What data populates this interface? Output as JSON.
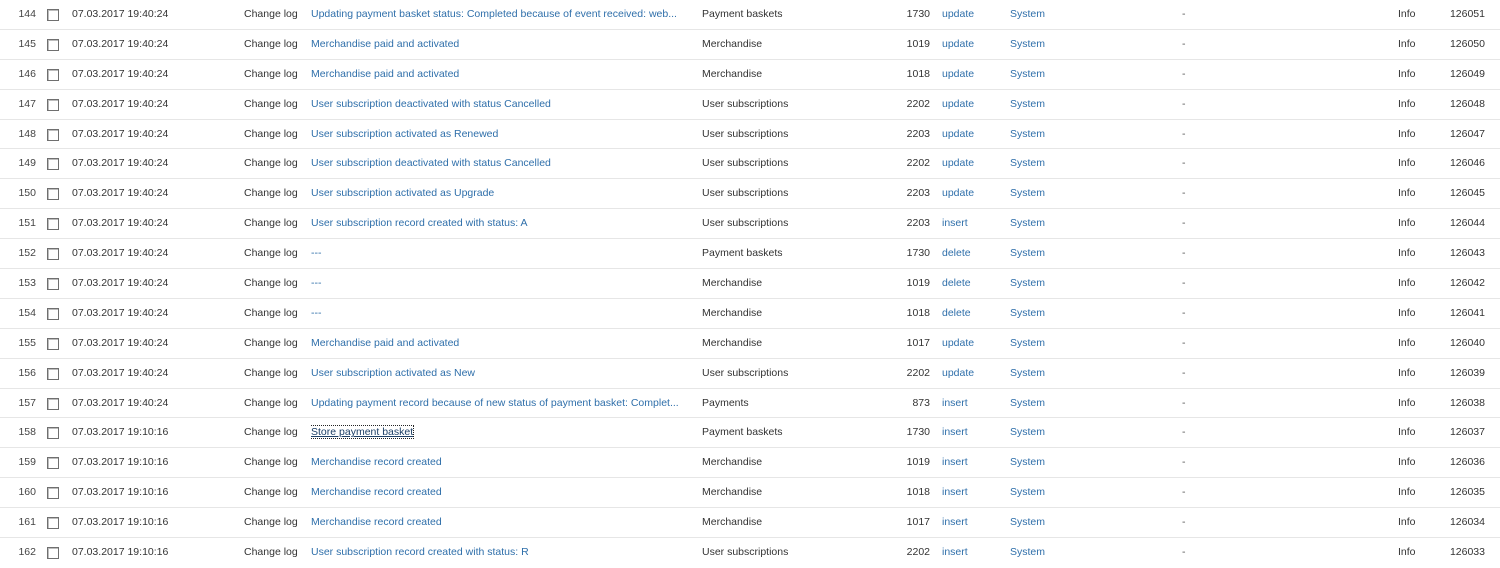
{
  "log": {
    "rows": [
      {
        "num": "144",
        "date": "07.03.2017 19:40:24",
        "type": "Change log",
        "message": "Updating payment basket status: Completed because of event received: web...",
        "object": "Payment baskets",
        "object_id": "1730",
        "action": "update",
        "user": "System",
        "dash": "-",
        "level": "Info",
        "record_id": "126051"
      },
      {
        "num": "145",
        "date": "07.03.2017 19:40:24",
        "type": "Change log",
        "message": "Merchandise paid and activated",
        "object": "Merchandise",
        "object_id": "1019",
        "action": "update",
        "user": "System",
        "dash": "-",
        "level": "Info",
        "record_id": "126050"
      },
      {
        "num": "146",
        "date": "07.03.2017 19:40:24",
        "type": "Change log",
        "message": "Merchandise paid and activated",
        "object": "Merchandise",
        "object_id": "1018",
        "action": "update",
        "user": "System",
        "dash": "-",
        "level": "Info",
        "record_id": "126049"
      },
      {
        "num": "147",
        "date": "07.03.2017 19:40:24",
        "type": "Change log",
        "message": "User subscription deactivated with status Cancelled",
        "object": "User subscriptions",
        "object_id": "2202",
        "action": "update",
        "user": "System",
        "dash": "-",
        "level": "Info",
        "record_id": "126048"
      },
      {
        "num": "148",
        "date": "07.03.2017 19:40:24",
        "type": "Change log",
        "message": "User subscription activated as Renewed",
        "object": "User subscriptions",
        "object_id": "2203",
        "action": "update",
        "user": "System",
        "dash": "-",
        "level": "Info",
        "record_id": "126047"
      },
      {
        "num": "149",
        "date": "07.03.2017 19:40:24",
        "type": "Change log",
        "message": "User subscription deactivated with status Cancelled",
        "object": "User subscriptions",
        "object_id": "2202",
        "action": "update",
        "user": "System",
        "dash": "-",
        "level": "Info",
        "record_id": "126046"
      },
      {
        "num": "150",
        "date": "07.03.2017 19:40:24",
        "type": "Change log",
        "message": "User subscription activated as Upgrade",
        "object": "User subscriptions",
        "object_id": "2203",
        "action": "update",
        "user": "System",
        "dash": "-",
        "level": "Info",
        "record_id": "126045"
      },
      {
        "num": "151",
        "date": "07.03.2017 19:40:24",
        "type": "Change log",
        "message": "User subscription record created with status: A",
        "object": "User subscriptions",
        "object_id": "2203",
        "action": "insert",
        "user": "System",
        "dash": "-",
        "level": "Info",
        "record_id": "126044"
      },
      {
        "num": "152",
        "date": "07.03.2017 19:40:24",
        "type": "Change log",
        "message": "---",
        "object": "Payment baskets",
        "object_id": "1730",
        "action": "delete",
        "user": "System",
        "dash": "-",
        "level": "Info",
        "record_id": "126043"
      },
      {
        "num": "153",
        "date": "07.03.2017 19:40:24",
        "type": "Change log",
        "message": "---",
        "object": "Merchandise",
        "object_id": "1019",
        "action": "delete",
        "user": "System",
        "dash": "-",
        "level": "Info",
        "record_id": "126042"
      },
      {
        "num": "154",
        "date": "07.03.2017 19:40:24",
        "type": "Change log",
        "message": "---",
        "object": "Merchandise",
        "object_id": "1018",
        "action": "delete",
        "user": "System",
        "dash": "-",
        "level": "Info",
        "record_id": "126041"
      },
      {
        "num": "155",
        "date": "07.03.2017 19:40:24",
        "type": "Change log",
        "message": "Merchandise paid and activated",
        "object": "Merchandise",
        "object_id": "1017",
        "action": "update",
        "user": "System",
        "dash": "-",
        "level": "Info",
        "record_id": "126040"
      },
      {
        "num": "156",
        "date": "07.03.2017 19:40:24",
        "type": "Change log",
        "message": "User subscription activated as New",
        "object": "User subscriptions",
        "object_id": "2202",
        "action": "update",
        "user": "System",
        "dash": "-",
        "level": "Info",
        "record_id": "126039"
      },
      {
        "num": "157",
        "date": "07.03.2017 19:40:24",
        "type": "Change log",
        "message": "Updating payment record because of new status of payment basket: Complet...",
        "object": "Payments",
        "object_id": "873",
        "action": "insert",
        "user": "System",
        "dash": "-",
        "level": "Info",
        "record_id": "126038"
      },
      {
        "num": "158",
        "date": "07.03.2017 19:10:16",
        "type": "Change log",
        "message": "Store payment basket",
        "object": "Payment baskets",
        "object_id": "1730",
        "action": "insert",
        "user": "System",
        "dash": "-",
        "level": "Info",
        "record_id": "126037"
      },
      {
        "num": "159",
        "date": "07.03.2017 19:10:16",
        "type": "Change log",
        "message": "Merchandise record created",
        "object": "Merchandise",
        "object_id": "1019",
        "action": "insert",
        "user": "System",
        "dash": "-",
        "level": "Info",
        "record_id": "126036"
      },
      {
        "num": "160",
        "date": "07.03.2017 19:10:16",
        "type": "Change log",
        "message": "Merchandise record created",
        "object": "Merchandise",
        "object_id": "1018",
        "action": "insert",
        "user": "System",
        "dash": "-",
        "level": "Info",
        "record_id": "126035"
      },
      {
        "num": "161",
        "date": "07.03.2017 19:10:16",
        "type": "Change log",
        "message": "Merchandise record created",
        "object": "Merchandise",
        "object_id": "1017",
        "action": "insert",
        "user": "System",
        "dash": "-",
        "level": "Info",
        "record_id": "126034"
      },
      {
        "num": "162",
        "date": "07.03.2017 19:10:16",
        "type": "Change log",
        "message": "User subscription record created with status: R",
        "object": "User subscriptions",
        "object_id": "2202",
        "action": "insert",
        "user": "System",
        "dash": "-",
        "level": "Info",
        "record_id": "126033"
      }
    ]
  },
  "colors": {
    "link": "#2f6faa",
    "text": "#333333",
    "divider": "#e6e6e6"
  }
}
